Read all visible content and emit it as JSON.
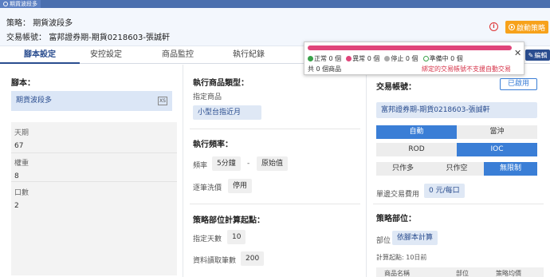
{
  "window": {
    "tab_title": "期貨波段多"
  },
  "header": {
    "strategy_label": "策略：",
    "strategy_value": "期貨波段多",
    "account_label": "交易帳號：",
    "account_value": "富邦證券期-期貨0218603-張誠軒",
    "start_button": "啟動策略"
  },
  "tabs": [
    {
      "label": "腳本設定",
      "active": true
    },
    {
      "label": "安控設定",
      "active": false
    },
    {
      "label": "商品監控",
      "active": false
    },
    {
      "label": "執行紀錄",
      "active": false
    }
  ],
  "edit_button": "編輯",
  "script": {
    "title": "腳本：",
    "name": "期貨波段多",
    "clear_icon": "XS",
    "params": [
      {
        "key": "天期",
        "value": "67"
      },
      {
        "key": "權重",
        "value": "8"
      },
      {
        "key": "口數",
        "value": "2"
      }
    ]
  },
  "exec": {
    "type_title": "執行商品類型：",
    "type_label": "指定商品",
    "type_value": "小型台指近月",
    "freq_title": "執行頻率：",
    "freq_label": "頻率",
    "freq_value": "5分鐘",
    "freq_sep": "-",
    "freq_source": "原始值",
    "tick_label": "逐筆洗價",
    "tick_value": "停用",
    "calc_title": "策略部位計算起點：",
    "days_label": "指定天數",
    "days_value": "10",
    "records_label": "資料讀取筆數",
    "records_value": "200"
  },
  "trade": {
    "title": "交易帳號：",
    "enabled": "已啟用",
    "account": "富邦證券期-期貨0218603-張誠軒",
    "mode": [
      "自動",
      "當沖"
    ],
    "order_type": [
      "ROD",
      "IOC"
    ],
    "direction": [
      "只作多",
      "只作空",
      "無限制"
    ],
    "fee_label": "單邊交易費用",
    "fee_value": "0 元/每口",
    "position_title": "策略部位：",
    "position_label": "部位",
    "position_value": "依腳本計算",
    "calc_start": "計算起點: 10日前",
    "table_headers": [
      "商品名稱",
      "部位",
      "策略均價"
    ]
  },
  "popup": {
    "stats": [
      {
        "label": "正常 0 個",
        "color": "#3aa14a",
        "style": "filled"
      },
      {
        "label": "異常 0 個",
        "color": "#e0457a",
        "style": "filled"
      },
      {
        "label": "停止 0 個",
        "color": "#aaaaaa",
        "style": "filled"
      },
      {
        "label": "準備中 0 個",
        "color": "#3aa14a",
        "style": "ring"
      }
    ],
    "summary": "共  0  個商品",
    "warning": "綁定的交易帳號不支援自動交易",
    "close": "✕"
  },
  "colors": {
    "accent": "#3a7ed6",
    "brand": "#2a4d8f",
    "start": "#f7a21b",
    "alert": "#e0457a"
  }
}
